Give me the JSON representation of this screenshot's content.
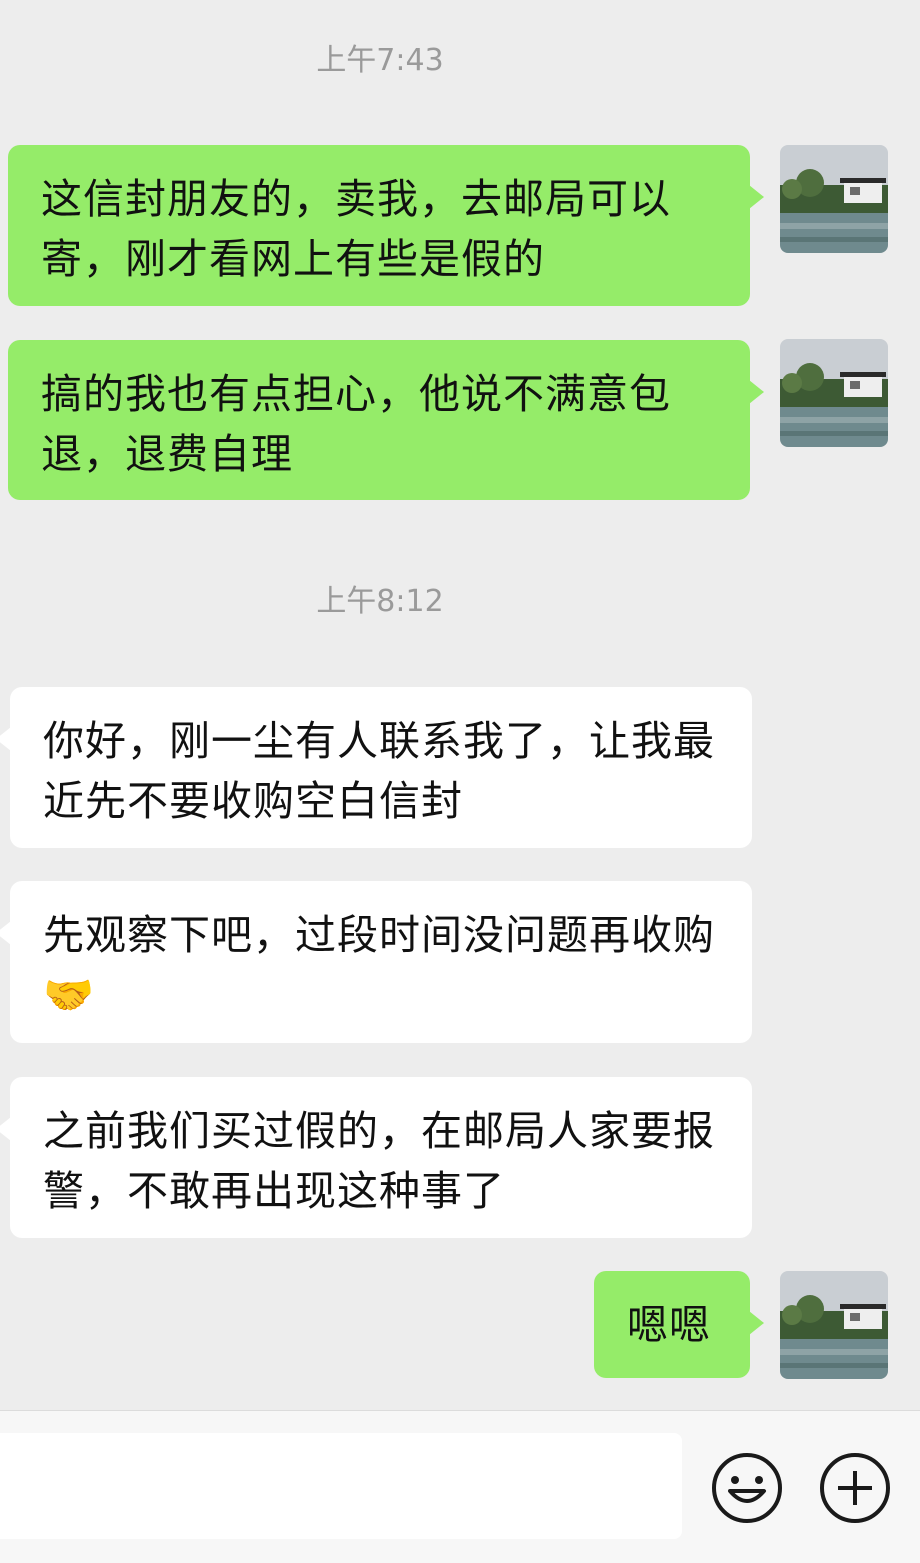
{
  "chat": {
    "timestamps": [
      "上午7:43",
      "上午8:12"
    ],
    "messages": [
      {
        "direction": "sent",
        "text": "这信封朋友的，卖我，去邮局可以寄，刚才看网上有些是假的"
      },
      {
        "direction": "sent",
        "text": "搞的我也有点担心，他说不满意包退，退费自理"
      },
      {
        "direction": "received",
        "text": "你好，刚一尘有人联系我了，让我最近先不要收购空白信封"
      },
      {
        "direction": "received",
        "text": "先观察下吧，过段时间没问题再收购🤝"
      },
      {
        "direction": "received",
        "text": "之前我们买过假的，在邮局人家要报警，不敢再出现这种事了"
      },
      {
        "direction": "sent",
        "text": "嗯嗯"
      }
    ]
  },
  "input_bar": {
    "text_input_value": "",
    "icons": [
      "emoji-icon",
      "plus-icon"
    ]
  },
  "colors": {
    "sent_bubble": "#95ec69",
    "received_bubble": "#ffffff",
    "background": "#ededed",
    "timestamp_text": "#9a9a9a"
  }
}
